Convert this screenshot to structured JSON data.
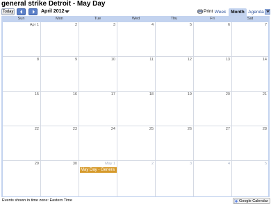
{
  "calendar": {
    "title": "general strike Detroit - May Day",
    "current_month": "April 2012",
    "timezone_note": "Events shown in time zone: Eastern Time"
  },
  "toolbar": {
    "today_label": "Today",
    "prev_icon": "chevron-left-icon",
    "next_icon": "chevron-right-icon",
    "print_label": "Print",
    "views": [
      {
        "label": "Week",
        "active": false
      },
      {
        "label": "Month",
        "active": true
      },
      {
        "label": "Agenda",
        "active": false
      }
    ]
  },
  "day_headers": [
    "Sun",
    "Mon",
    "Tue",
    "Wed",
    "Thu",
    "Fri",
    "Sat"
  ],
  "weeks": [
    [
      {
        "label": "Apr 1",
        "current": true
      },
      {
        "label": "2",
        "current": true
      },
      {
        "label": "3",
        "current": true
      },
      {
        "label": "4",
        "current": true
      },
      {
        "label": "5",
        "current": true
      },
      {
        "label": "6",
        "current": true
      },
      {
        "label": "7",
        "current": true
      }
    ],
    [
      {
        "label": "8",
        "current": true
      },
      {
        "label": "9",
        "current": true
      },
      {
        "label": "10",
        "current": true
      },
      {
        "label": "11",
        "current": true
      },
      {
        "label": "12",
        "current": true
      },
      {
        "label": "13",
        "current": true
      },
      {
        "label": "14",
        "current": true
      }
    ],
    [
      {
        "label": "15",
        "current": true
      },
      {
        "label": "16",
        "current": true
      },
      {
        "label": "17",
        "current": true
      },
      {
        "label": "18",
        "current": true
      },
      {
        "label": "19",
        "current": true
      },
      {
        "label": "20",
        "current": true
      },
      {
        "label": "21",
        "current": true
      }
    ],
    [
      {
        "label": "22",
        "current": true
      },
      {
        "label": "23",
        "current": true
      },
      {
        "label": "24",
        "current": true
      },
      {
        "label": "25",
        "current": true
      },
      {
        "label": "26",
        "current": true
      },
      {
        "label": "27",
        "current": true
      },
      {
        "label": "28",
        "current": true
      }
    ],
    [
      {
        "label": "29",
        "current": true
      },
      {
        "label": "30",
        "current": true
      },
      {
        "label": "May 1",
        "current": false
      },
      {
        "label": "2",
        "current": false
      },
      {
        "label": "3",
        "current": false
      },
      {
        "label": "4",
        "current": false
      },
      {
        "label": "5",
        "current": false
      }
    ]
  ],
  "events": [
    {
      "title": "May Day - Genera",
      "date": "May 1",
      "color": "#d69a2b"
    }
  ],
  "branding": {
    "google_calendar_label": "Google Calendar"
  },
  "colors": {
    "accent": "#c3d3ef",
    "nav_button": "#5b7fc7",
    "event": "#d69a2b"
  }
}
